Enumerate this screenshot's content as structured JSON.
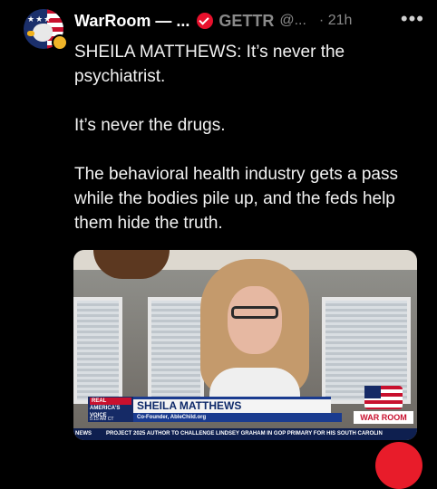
{
  "post": {
    "author_name": "WarRoom — ...",
    "platform": "GETTR",
    "handle": "@...",
    "separator": "·",
    "time": "21h",
    "more_label": "•••",
    "paragraphs": [
      "SHEILA MATTHEWS: It’s never the psychiatrist.",
      "It’s never the drugs.",
      "The behavioral health industry gets a pass while the bodies pile up, and the feds help them hide the truth."
    ]
  },
  "video": {
    "network": "REAL AMERICA'S VOICE",
    "network_line1": "REAL",
    "network_line2": "AMERICA'S",
    "network_line3": "VOICE",
    "timestamp": "5:15 AM CT",
    "guest_name": "SHEILA MATTHEWS",
    "guest_title": "Co-Founder, AbleChild.org",
    "ticker_label": "NEWS",
    "ticker_text": "PROJECT 2025 AUTHOR TO CHALLENGE LINDSEY GRAHAM IN GOP PRIMARY FOR HIS SOUTH CAROLIN",
    "show_logo": "WAR ROOM"
  },
  "colors": {
    "background": "#000000",
    "gettr_red": "#e8112d",
    "muted_text": "#8a8a8a",
    "chyron_blue": "#1a3b8f"
  },
  "icons": {
    "avatar": "warroom-eagle-flag-avatar",
    "verified": "gold-badge-icon",
    "platform": "gettr-check-icon",
    "more": "more-dots-icon"
  }
}
